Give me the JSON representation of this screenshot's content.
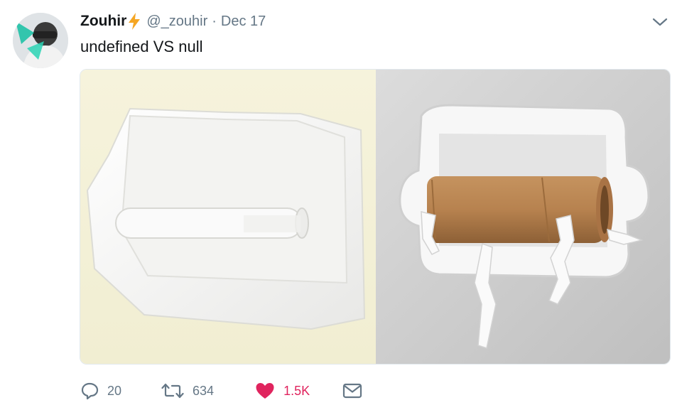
{
  "tweet": {
    "author_name": "Zouhir",
    "handle": "@_zouhir",
    "separator": "·",
    "date": "Dec 17",
    "text": "undefined VS null",
    "icons": {
      "verified_badge": "lightning-bolt-icon",
      "menu": "chevron-down-icon",
      "reply": "reply-icon",
      "retweet": "retweet-icon",
      "like": "heart-icon",
      "dm": "envelope-icon"
    },
    "colors": {
      "bolt": "#f5a623",
      "like_active": "#e0245e",
      "secondary_text": "#657786"
    },
    "actions": {
      "reply_count": "20",
      "retweet_count": "634",
      "like_count": "1.5K"
    }
  }
}
